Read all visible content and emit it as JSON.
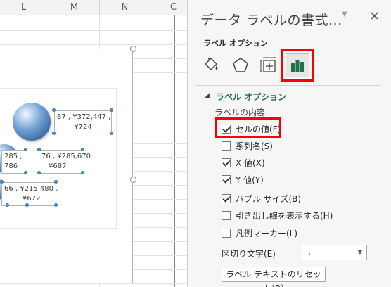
{
  "sheet": {
    "columns": [
      "L",
      "M",
      "N",
      "C"
    ],
    "labels": [
      {
        "line1": "87 , ¥372,447 ,",
        "line2": "¥724"
      },
      {
        "line1": "76 , ¥285,670 ,",
        "line2": "¥687"
      },
      {
        "line1": "285 ,",
        "line2": "786"
      },
      {
        "line1": "66 , ¥215,480 ,",
        "line2": "¥672"
      }
    ]
  },
  "pane": {
    "title": "データ ラベルの書式...",
    "menu_icon": "▼",
    "close": "×",
    "section": "ラベル オプション",
    "tabs": [
      "fill-line-icon",
      "effects-icon",
      "size-properties-icon",
      "label-options-icon"
    ],
    "group_title": "ラベル オプション",
    "contents_label": "ラベルの内容",
    "options": [
      {
        "label": "セルの値(F)",
        "checked": true
      },
      {
        "label": "系列名(S)",
        "checked": false
      },
      {
        "label": "X 値(X)",
        "checked": true
      },
      {
        "label": "Y 値(Y)",
        "checked": true
      },
      {
        "label": "バブル サイズ(B)",
        "checked": true
      },
      {
        "label": "引き出し線を表示する(H)",
        "checked": false
      },
      {
        "label": "凡例マーカー(L)",
        "checked": false
      }
    ],
    "separator_label": "区切り文字(E)",
    "separator_value": ",",
    "reset_button": "ラベル テキストのリセット(R)",
    "highlight_color": "#ff0000",
    "accent_color": "#217346"
  }
}
